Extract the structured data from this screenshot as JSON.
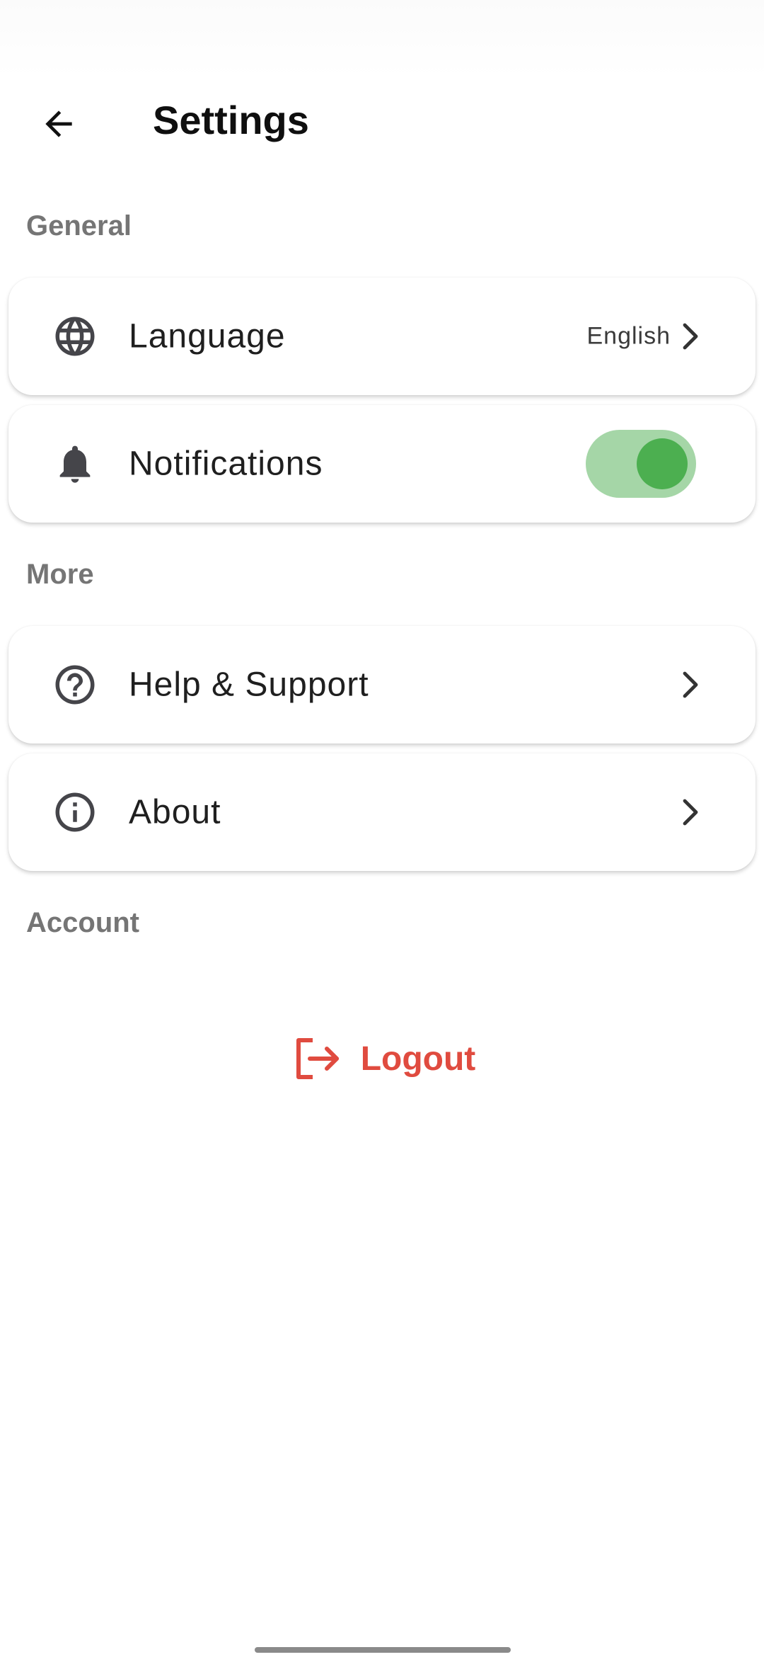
{
  "header": {
    "title": "Settings",
    "back_icon": "arrow-left-icon"
  },
  "sections": {
    "general": "General",
    "more": "More",
    "account": "Account"
  },
  "items": {
    "language": {
      "label": "Language",
      "value": "English",
      "icon": "globe-icon"
    },
    "notifications": {
      "label": "Notifications",
      "enabled": true,
      "icon": "bell-icon"
    },
    "help": {
      "label": "Help & Support",
      "icon": "question-circle-icon"
    },
    "about": {
      "label": "About",
      "icon": "info-circle-icon"
    }
  },
  "logout": {
    "label": "Logout",
    "icon": "logout-icon",
    "color": "#e04b3f"
  },
  "colors": {
    "toggle_track": "#a5d6a7",
    "toggle_knob": "#4caf50",
    "section_label": "#757575",
    "icon": "#45454a"
  }
}
